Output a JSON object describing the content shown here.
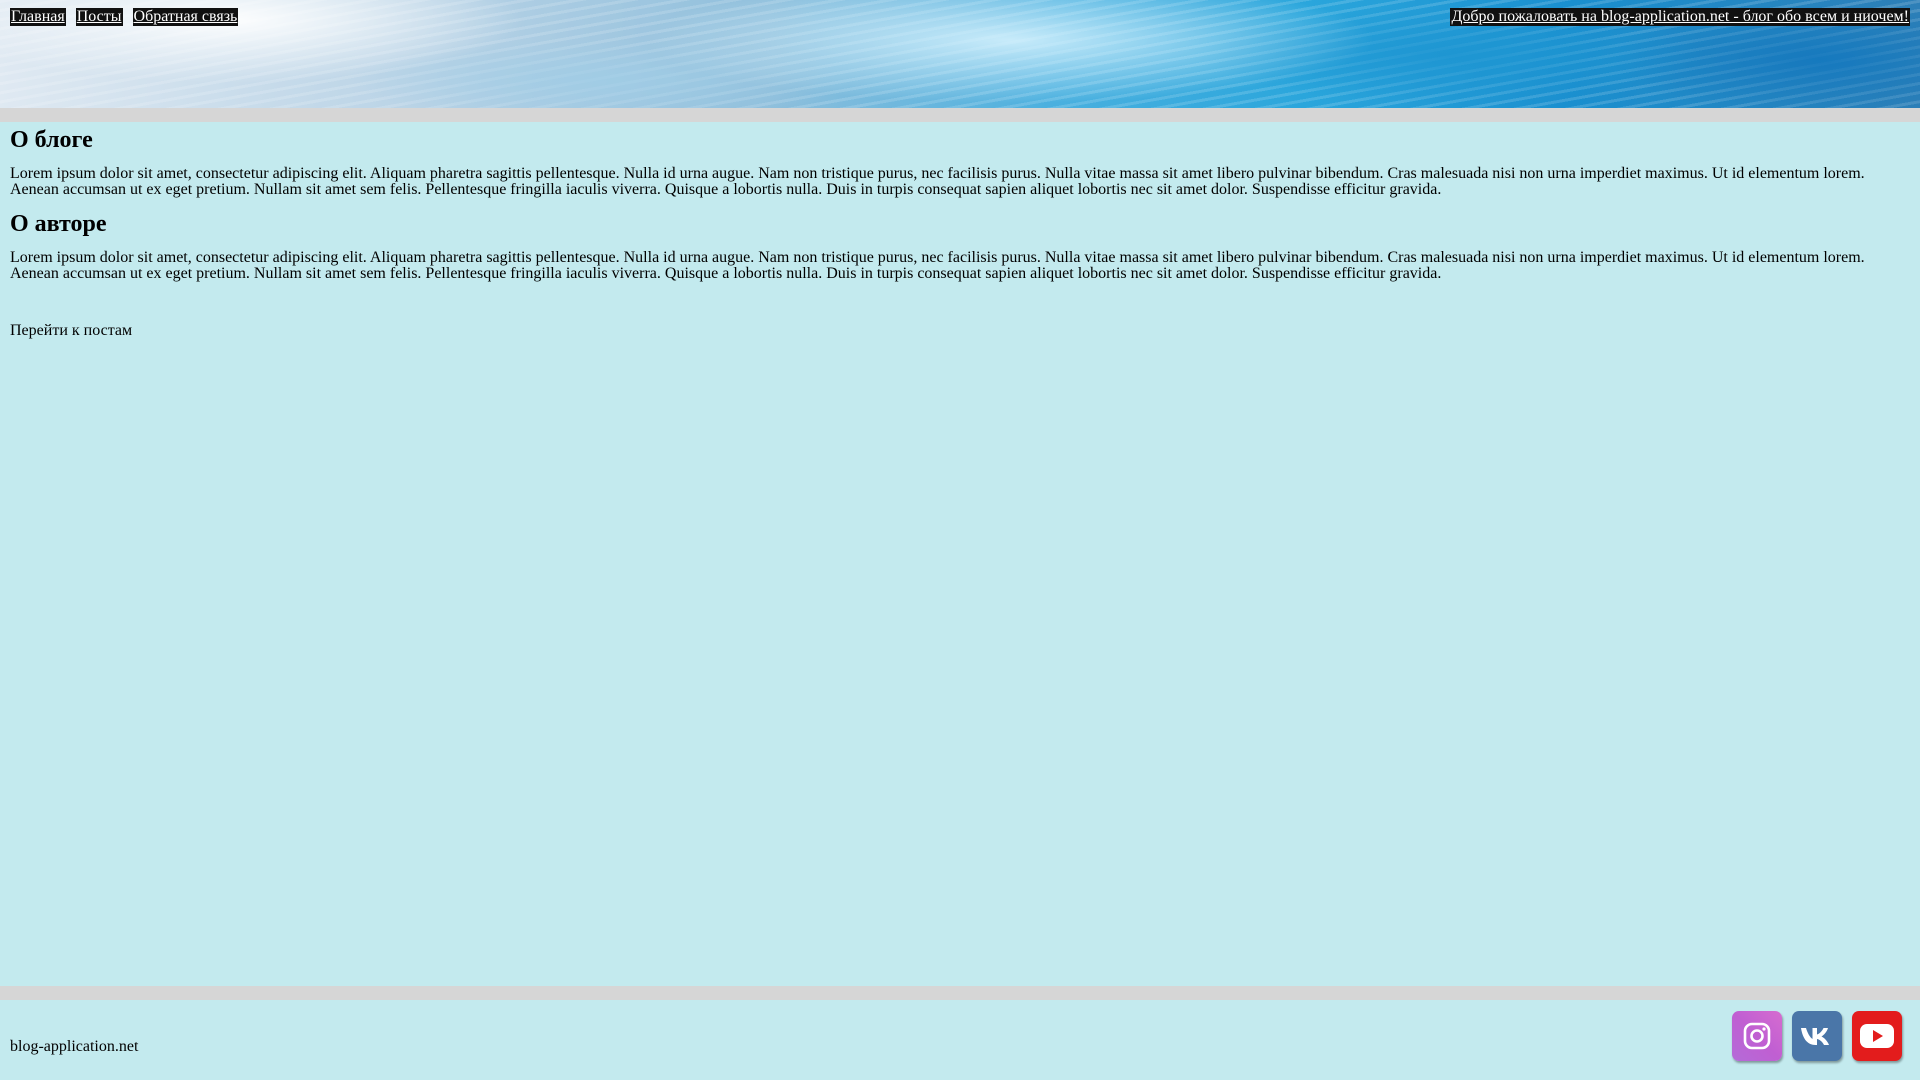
{
  "header": {
    "nav": [
      {
        "label": "Главная"
      },
      {
        "label": "Посты"
      },
      {
        "label": "Обратная связь"
      }
    ],
    "welcome": "Добро пожаловать на blog-application.net - блог обо всем и ниочем!"
  },
  "main": {
    "sections": [
      {
        "title": "О блоге",
        "text": "Lorem ipsum dolor sit amet, consectetur adipiscing elit. Aliquam pharetra sagittis pellentesque. Nulla id urna augue. Nam non tristique purus, nec facilisis purus. Nulla vitae massa sit amet libero pulvinar bibendum. Cras malesuada nisi non urna imperdiet maximus. Ut id elementum lorem. Aenean accumsan ut ex eget pretium. Nullam sit amet sem felis. Pellentesque fringilla iaculis viverra. Quisque a lobortis nulla. Duis in turpis consequat sapien aliquet lobortis nec sit amet dolor. Suspendisse efficitur gravida."
      },
      {
        "title": "О авторе",
        "text": "Lorem ipsum dolor sit amet, consectetur adipiscing elit. Aliquam pharetra sagittis pellentesque. Nulla id urna augue. Nam non tristique purus, nec facilisis purus. Nulla vitae massa sit amet libero pulvinar bibendum. Cras malesuada nisi non urna imperdiet maximus. Ut id elementum lorem. Aenean accumsan ut ex eget pretium. Nullam sit amet sem felis. Pellentesque fringilla iaculis viverra. Quisque a lobortis nulla. Duis in turpis consequat sapien aliquet lobortis nec sit amet dolor. Suspendisse efficitur gravida."
      }
    ],
    "posts_link": "Перейти к постам"
  },
  "footer": {
    "site": "blog-application.net",
    "social": [
      {
        "icon": "instagram-icon",
        "color": "#c05fd2"
      },
      {
        "icon": "vk-icon",
        "color": "#4a76a8"
      },
      {
        "icon": "youtube-icon",
        "color": "#e31c1c"
      }
    ]
  },
  "colors": {
    "background": "#c3eaee",
    "divider": "#d6d6d6",
    "nav_bg": "#111111"
  }
}
